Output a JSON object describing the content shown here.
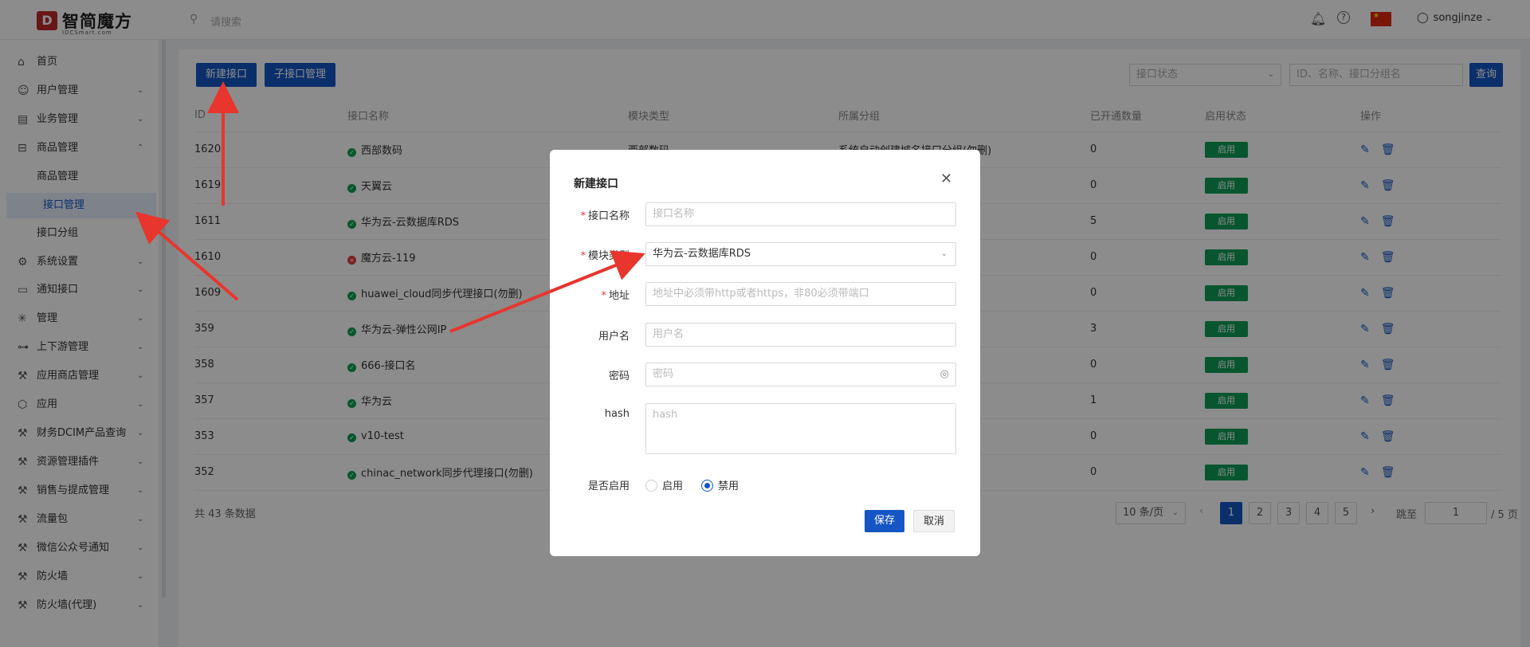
{
  "header": {
    "logo_mark": "D",
    "logo_name": "智简魔方",
    "logo_sub": "IDCSmart.com",
    "search_placeholder": "请搜索",
    "username": "songjinze"
  },
  "sidebar": {
    "items": [
      {
        "label": "首页",
        "icon": "home-icon",
        "glyph": "⌂",
        "expand": ""
      },
      {
        "label": "用户管理",
        "icon": "user-icon",
        "glyph": "☺",
        "expand": "⌄"
      },
      {
        "label": "业务管理",
        "icon": "list-icon",
        "glyph": "▤",
        "expand": "⌄"
      },
      {
        "label": "商品管理",
        "icon": "cart-icon",
        "glyph": "⊟",
        "expand": "⌃"
      },
      {
        "label": "商品管理",
        "icon": "",
        "glyph": "",
        "expand": ""
      },
      {
        "label": "接口管理",
        "icon": "",
        "glyph": "",
        "expand": ""
      },
      {
        "label": "接口分组",
        "icon": "",
        "glyph": "",
        "expand": ""
      },
      {
        "label": "系统设置",
        "icon": "gear-icon",
        "glyph": "⚙",
        "expand": "⌄"
      },
      {
        "label": "通知接口",
        "icon": "folder-icon",
        "glyph": "▭",
        "expand": "⌄"
      },
      {
        "label": "管理",
        "icon": "asterisk-icon",
        "glyph": "✳",
        "expand": "⌄"
      },
      {
        "label": "上下游管理",
        "icon": "tree-icon",
        "glyph": "⊶",
        "expand": "⌄"
      },
      {
        "label": "应用商店管理",
        "icon": "wrench-icon",
        "glyph": "⚒",
        "expand": "⌄"
      },
      {
        "label": "应用",
        "icon": "box-icon",
        "glyph": "⬡",
        "expand": "⌄"
      },
      {
        "label": "财务DCIM产品查询",
        "icon": "wrench-icon",
        "glyph": "⚒",
        "expand": "⌄"
      },
      {
        "label": "资源管理插件",
        "icon": "wrench-icon",
        "glyph": "⚒",
        "expand": "⌄"
      },
      {
        "label": "销售与提成管理",
        "icon": "wrench-icon",
        "glyph": "⚒",
        "expand": "⌄"
      },
      {
        "label": "流量包",
        "icon": "wrench-icon",
        "glyph": "⚒",
        "expand": "⌄"
      },
      {
        "label": "微信公众号通知",
        "icon": "wrench-icon",
        "glyph": "⚒",
        "expand": "⌄"
      },
      {
        "label": "防火墙",
        "icon": "wrench-icon",
        "glyph": "⚒",
        "expand": "⌄"
      },
      {
        "label": "防火墙(代理)",
        "icon": "wrench-icon",
        "glyph": "⚒",
        "expand": "⌄"
      }
    ]
  },
  "toolbar": {
    "new_button": "新建接口",
    "sub_button": "子接口管理",
    "status_placeholder": "接口状态",
    "query_placeholder": "ID、名称、接口分组名",
    "query_button": "查询"
  },
  "table": {
    "headers": [
      "ID",
      "接口名称",
      "模块类型",
      "所属分组",
      "已开通数量",
      "启用状态",
      "操作"
    ],
    "rows": [
      {
        "id": "1620",
        "name": "西部数码",
        "status": "ok",
        "module": "西部数码",
        "group": "系统自动创建城名接口分组(勿删)",
        "count": "0",
        "enabled": "启用"
      },
      {
        "id": "1619",
        "name": "天翼云",
        "status": "ok",
        "module": "",
        "group": "",
        "count": "0",
        "enabled": "启用"
      },
      {
        "id": "1611",
        "name": "华为云-云数据库RDS",
        "status": "ok",
        "module": "",
        "group": "",
        "count": "5",
        "enabled": "启用"
      },
      {
        "id": "1610",
        "name": "魔方云-119",
        "status": "err",
        "module": "",
        "group": "",
        "count": "0",
        "enabled": "启用"
      },
      {
        "id": "1609",
        "name": "huawei_cloud同步代理接口(勿删)",
        "status": "ok",
        "module": "",
        "group": "",
        "count": "0",
        "enabled": "启用"
      },
      {
        "id": "359",
        "name": "华为云-弹性公网IP",
        "status": "ok",
        "module": "",
        "group": "",
        "count": "3",
        "enabled": "启用"
      },
      {
        "id": "358",
        "name": "666-接口名",
        "status": "ok",
        "module": "",
        "group": "",
        "count": "0",
        "enabled": "启用"
      },
      {
        "id": "357",
        "name": "华为云",
        "status": "ok",
        "module": "",
        "group": "",
        "count": "1",
        "enabled": "启用"
      },
      {
        "id": "353",
        "name": "v10-test",
        "status": "ok",
        "module": "",
        "group": "",
        "count": "0",
        "enabled": "启用"
      },
      {
        "id": "352",
        "name": "chinac_network同步代理接口(勿删)",
        "status": "ok",
        "module": "",
        "group": "",
        "count": "0",
        "enabled": "启用"
      }
    ]
  },
  "pagination": {
    "total": "共 43 条数据",
    "page_size": "10 条/页",
    "pages": [
      "1",
      "2",
      "3",
      "4",
      "5"
    ],
    "current": "1",
    "jump_label": "跳至",
    "jump_value": "1",
    "total_pages": "/ 5 页"
  },
  "modal": {
    "title": "新建接口",
    "fields": {
      "name_label": "接口名称",
      "name_placeholder": "接口名称",
      "module_label": "模块类型",
      "module_value": "华为云-云数据库RDS",
      "address_label": "地址",
      "address_placeholder": "地址中必须带http或者https，非80必须带端口",
      "username_label": "用户名",
      "username_placeholder": "用户名",
      "password_label": "密码",
      "password_placeholder": "密码",
      "hash_label": "hash",
      "hash_placeholder": "hash",
      "enable_label": "是否启用",
      "enable_on": "启用",
      "enable_off": "禁用"
    },
    "save_button": "保存",
    "cancel_button": "取消"
  },
  "colors": {
    "primary": "#1556c4",
    "success": "#0f9d58",
    "danger": "#e23a3a",
    "annotation_arrow": "#e8352e"
  }
}
